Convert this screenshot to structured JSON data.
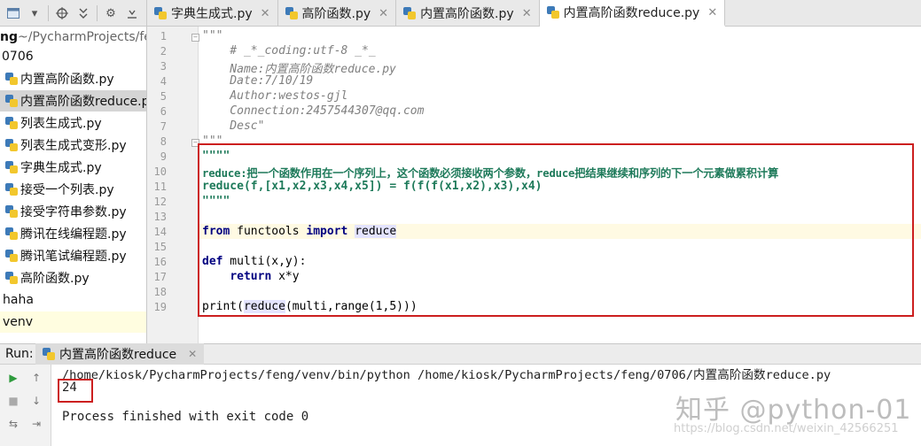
{
  "tabs": [
    {
      "label": "字典生成式.py",
      "active": false
    },
    {
      "label": "高阶函数.py",
      "active": false
    },
    {
      "label": "内置高阶函数.py",
      "active": false
    },
    {
      "label": "内置高阶函数reduce.py",
      "active": true
    }
  ],
  "project": {
    "root_name": "ng",
    "root_path": " ~/PycharmProjects/fe",
    "folder": "0706",
    "files": [
      "内置高阶函数.py",
      "内置高阶函数reduce.py",
      "列表生成式.py",
      "列表生成式变形.py",
      "字典生成式.py",
      "接受一个列表.py",
      "接受字符串参数.py",
      "腾讯在线编程题.py",
      "腾讯笔试编程题.py",
      "高阶函数.py"
    ],
    "folders_below": [
      "haha",
      "venv"
    ]
  },
  "editor": {
    "line_numbers": [
      "1",
      "2",
      "3",
      "4",
      "5",
      "6",
      "7",
      "8",
      "9",
      "10",
      "11",
      "12",
      "13",
      "14",
      "15",
      "16",
      "17",
      "18",
      "19"
    ],
    "lines": {
      "l1": "\"\"\"",
      "l2": "    # _*_coding:utf-8 _*_",
      "l3": "    Name:内置高阶函数reduce.py",
      "l4": "    Date:7/10/19",
      "l5": "    Author:westos-gjl",
      "l6": "    Connection:2457544307@qq.com",
      "l7": "    Desc\"",
      "l8": "\"\"\"",
      "l9": "\"\"\"\"",
      "l10": "reduce:把一个函数作用在一个序列上，这个函数必须接收两个参数，reduce把结果继续和序列的下一个元素做累积计算",
      "l11": "reduce(f,[x1,x2,x3,x4,x5]) = f(f(f(x1,x2),x3),x4)",
      "l12": "\"\"\"\"",
      "l14_kw1": "from",
      "l14_mod": " functools ",
      "l14_kw2": "import",
      "l14_sp": " ",
      "l14_name": "reduce",
      "l16_kw": "def",
      "l16_rest": " multi(x,y):",
      "l17_indent": "    ",
      "l17_kw": "return",
      "l17_rest": " x*y",
      "l19_a": "print(",
      "l19_name": "reduce",
      "l19_b": "(multi,range(1,5)))"
    }
  },
  "run": {
    "label": "Run:",
    "tab_label": "内置高阶函数reduce",
    "command": "/home/kiosk/PycharmProjects/feng/venv/bin/python /home/kiosk/PycharmProjects/feng/0706/内置高阶函数reduce.py",
    "output": "24",
    "exit_message": "Process finished with exit code 0"
  },
  "watermark": {
    "text": "知乎 @python-01",
    "url": "https://blog.csdn.net/weixin_42566251"
  },
  "colors": {
    "highlight_box": "#cc1f1f",
    "docstring": "#1e7a5a",
    "keyword": "#000080"
  }
}
